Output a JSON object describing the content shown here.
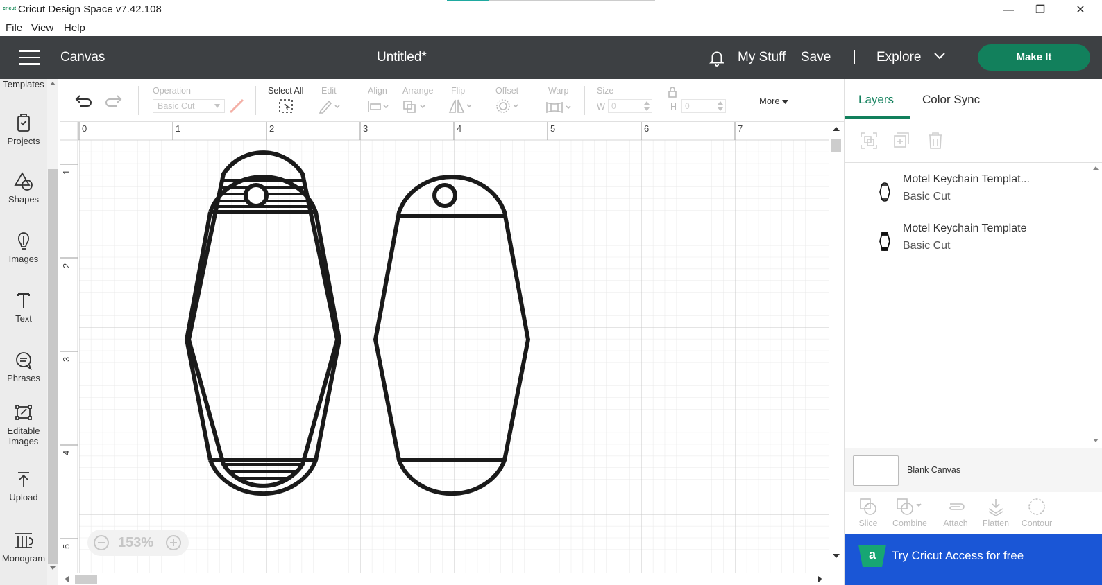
{
  "window": {
    "app_logo": "cricut",
    "title": "Cricut Design Space  v7.42.108",
    "buttons": {
      "minimize": "—",
      "restore": "❐",
      "close": "✕"
    }
  },
  "menu": {
    "items": [
      "File",
      "View",
      "Help"
    ]
  },
  "header": {
    "section": "Canvas",
    "document_title": "Untitled*",
    "my_stuff": "My Stuff",
    "save": "Save",
    "explore": "Explore",
    "make_it": "Make It",
    "brand_color": "#12805c"
  },
  "sidebar": {
    "items": [
      {
        "label": "Templates",
        "icon": "templates-icon"
      },
      {
        "label": "Projects",
        "icon": "projects-icon"
      },
      {
        "label": "Shapes",
        "icon": "shapes-icon"
      },
      {
        "label": "Images",
        "icon": "images-icon"
      },
      {
        "label": "Text",
        "icon": "text-icon"
      },
      {
        "label": "Phrases",
        "icon": "phrases-icon"
      },
      {
        "label": "Editable",
        "label2": "Images",
        "icon": "editable-images-icon"
      },
      {
        "label": "Upload",
        "icon": "upload-icon"
      },
      {
        "label": "Monogram",
        "icon": "monogram-icon"
      }
    ]
  },
  "toolbar": {
    "operation_label": "Operation",
    "operation_value": "Basic Cut",
    "select_all": "Select All",
    "edit": "Edit",
    "align": "Align",
    "arrange": "Arrange",
    "flip": "Flip",
    "offset": "Offset",
    "warp": "Warp",
    "size": "Size",
    "w_label": "W",
    "w_value": "0",
    "h_label": "H",
    "h_value": "0",
    "more": "More"
  },
  "canvas": {
    "ruler_x": [
      "0",
      "1",
      "2",
      "3",
      "4",
      "5",
      "6",
      "7"
    ],
    "ruler_y": [
      "1",
      "2",
      "3",
      "4",
      "5"
    ],
    "zoom": "153%"
  },
  "layers_panel": {
    "tabs": [
      "Layers",
      "Color Sync"
    ],
    "layers": [
      {
        "name": "Motel Keychain Templat...",
        "operation": "Basic Cut"
      },
      {
        "name": "Motel Keychain Template",
        "operation": "Basic Cut"
      }
    ],
    "blank_canvas": "Blank Canvas",
    "tools": [
      "Slice",
      "Combine",
      "Attach",
      "Flatten",
      "Contour"
    ],
    "access_logo": "a",
    "access_banner": "Try Cricut Access for free",
    "access_color": "#1a56d6"
  }
}
